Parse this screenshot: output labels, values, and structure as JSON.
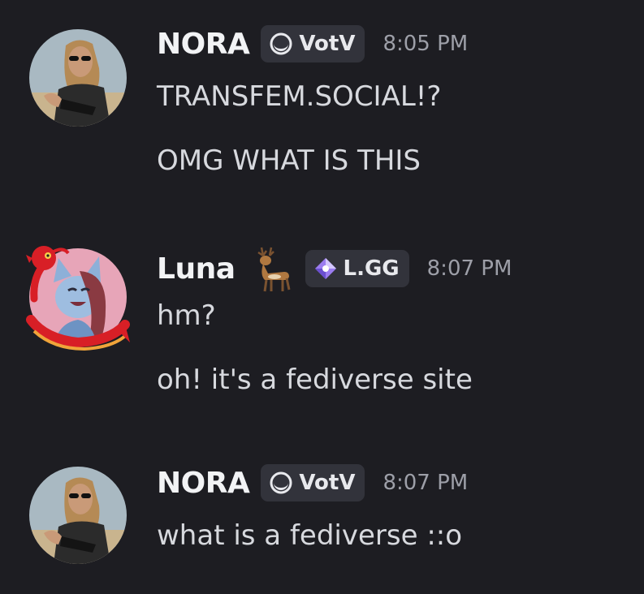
{
  "messages": [
    {
      "username": "NORA",
      "tag": "VotV",
      "time": "8:05 PM",
      "lines": [
        "TRANSFEM.SOCIAL!?",
        "OMG WHAT IS THIS"
      ],
      "avatar_icon": "woman-sunglasses-avatar",
      "tag_icon": "crescent-moon-icon"
    },
    {
      "username": "Luna",
      "username_emoji": "deer-emoji",
      "tag": "L.GG",
      "time": "8:07 PM",
      "lines": [
        "hm?",
        "oh! it's a fediverse site"
      ],
      "avatar_icon": "furry-character-avatar",
      "avatar_decoration": "red-dragon-frame",
      "tag_icon": "sparkle-diamond-icon"
    },
    {
      "username": "NORA",
      "tag": "VotV",
      "time": "8:07 PM",
      "lines": [
        "what is a fediverse ::o"
      ],
      "avatar_icon": "woman-sunglasses-avatar",
      "tag_icon": "crescent-moon-icon"
    }
  ],
  "colors": {
    "background": "#1d1d22",
    "username": "#f2f3f5",
    "message_text": "#d7d9de",
    "timestamp": "#9d9fa8",
    "tag_background": "#32333b",
    "dragon_red": "#d81f26"
  }
}
